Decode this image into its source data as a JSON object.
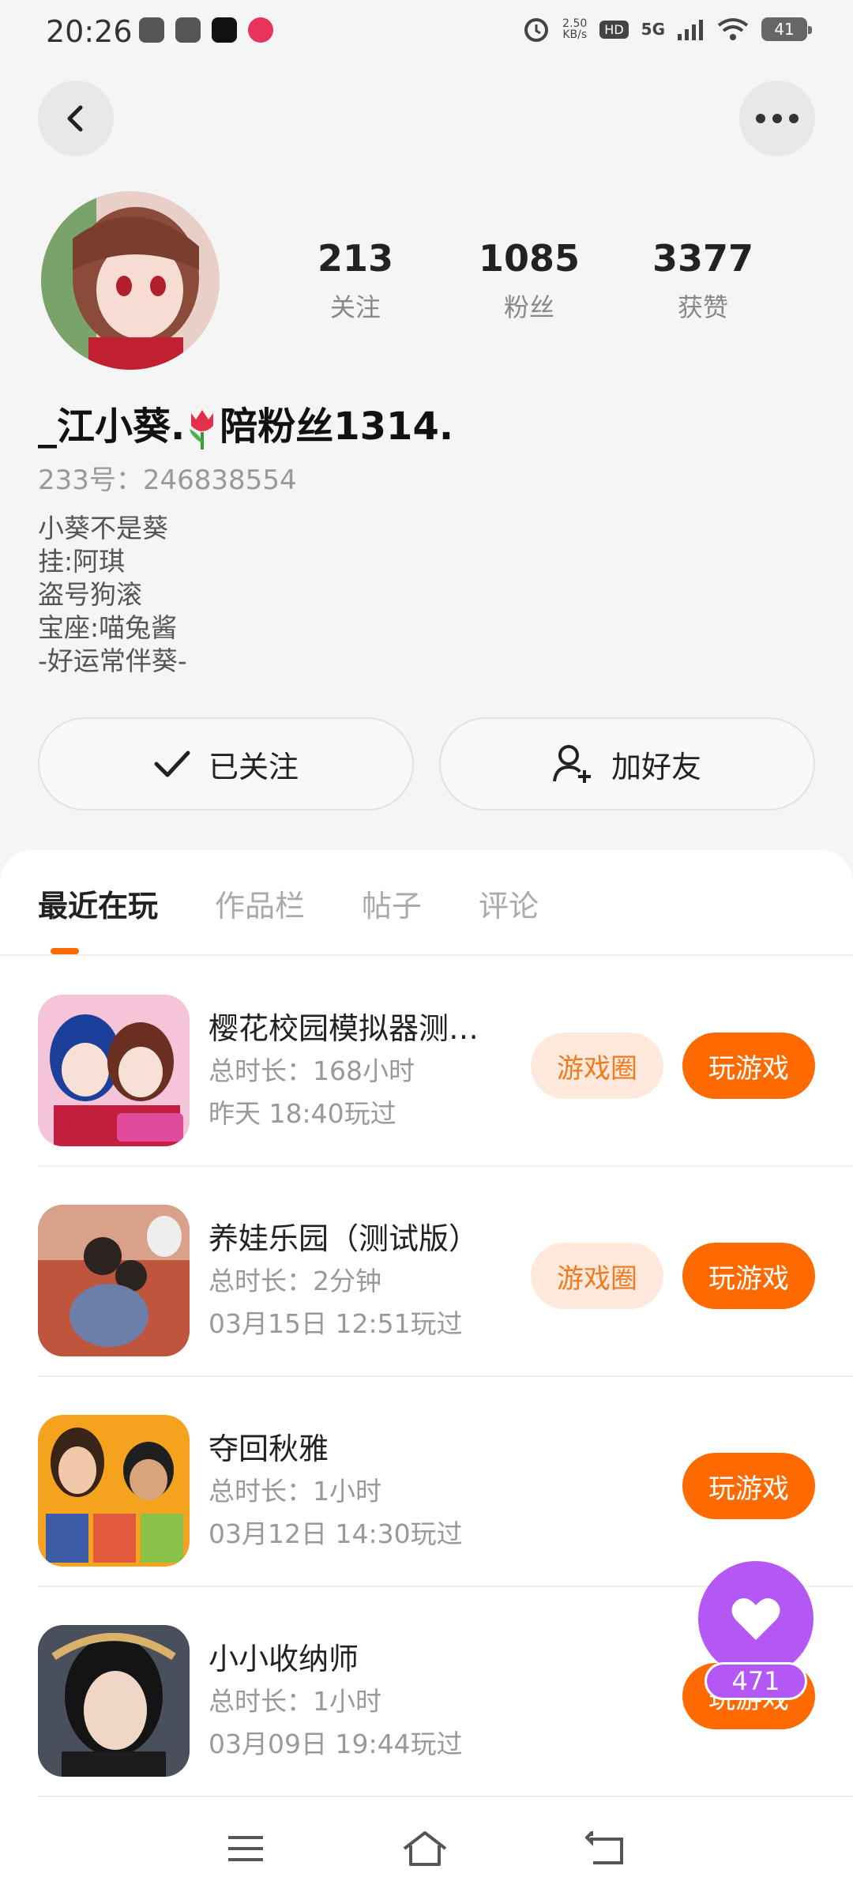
{
  "status_bar": {
    "time": "20:26",
    "speed_value": "2.50",
    "speed_unit": "KB/s",
    "hd": "HD",
    "network": "5G",
    "battery": "41"
  },
  "profile": {
    "stats": [
      {
        "value": "213",
        "label": "关注"
      },
      {
        "value": "1085",
        "label": "粉丝"
      },
      {
        "value": "3377",
        "label": "获赞"
      }
    ],
    "name_part1": "_江小葵.",
    "name_part2": "陪粉丝1314.",
    "uid": "233号：246838554",
    "bio": [
      "小葵不是葵",
      "挂:阿琪",
      "盗号狗滚",
      "宝座:喵兔酱",
      "-好运常伴葵-"
    ]
  },
  "actions": {
    "follow_label": "已关注",
    "friend_label": "加好友"
  },
  "tabs": [
    "最近在玩",
    "作品栏",
    "帖子",
    "评论"
  ],
  "games": [
    {
      "title": "樱花校园模拟器测…",
      "duration": "总时长：168小时",
      "last_played": "昨天 18:40玩过",
      "circle_label": "游戏圈",
      "play_label": "玩游戏",
      "icon_colors": [
        "#3a6fd8",
        "#f4c5d8"
      ]
    },
    {
      "title": "养娃乐园（测试版）",
      "duration": "总时长：2分钟",
      "last_played": "03月15日 12:51玩过",
      "circle_label": "游戏圈",
      "play_label": "玩游戏",
      "icon_colors": [
        "#c0553d",
        "#e8d6c8"
      ]
    },
    {
      "title": "夺回秋雅",
      "duration": "总时长：1小时",
      "last_played": "03月12日 14:30玩过",
      "play_label": "玩游戏",
      "icon_colors": [
        "#f5a21f",
        "#3b5da8"
      ]
    },
    {
      "title": "小小收纳师",
      "duration": "总时长：1小时",
      "last_played": "03月09日 19:44玩过",
      "play_label": "玩游戏",
      "icon_colors": [
        "#2c2f3a",
        "#d9b26a"
      ]
    }
  ],
  "float": {
    "count": "471"
  },
  "colors": {
    "accent": "#ff6a00",
    "float": "#b458f5"
  }
}
